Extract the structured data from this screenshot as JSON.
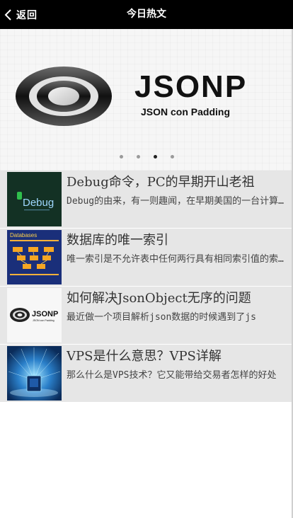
{
  "header": {
    "back_label": "返回",
    "title": "今日热文"
  },
  "banner": {
    "logo_text": "JSONP",
    "logo_subtitle": "JSON con Padding",
    "dots": 4,
    "active_dot": 3
  },
  "articles": [
    {
      "title": "Debug命令，PC的早期开山老祖",
      "desc": "Debug的由来，有一则趣闻，在早期美国的一台计算机",
      "thumb_icon": "debug-logo",
      "thumb_text": "Debug"
    },
    {
      "title": "数据库的唯一索引",
      "desc": "唯一索引是不允许表中任何两行具有相同索引值的索引。",
      "thumb_icon": "database-diagram",
      "thumb_text": "Databases"
    },
    {
      "title": "如何解决JsonObject无序的问题",
      "desc": "最近做一个项目解析json数据的时候遇到了js",
      "thumb_icon": "jsonp-logo",
      "thumb_text": "JSONP",
      "thumb_subtext": "JSON con Padding"
    },
    {
      "title": "VPS是什么意思？VPS详解",
      "desc": "那么什么是VPS技术？它又能带给交易者怎样的好处",
      "thumb_icon": "server-network"
    }
  ]
}
